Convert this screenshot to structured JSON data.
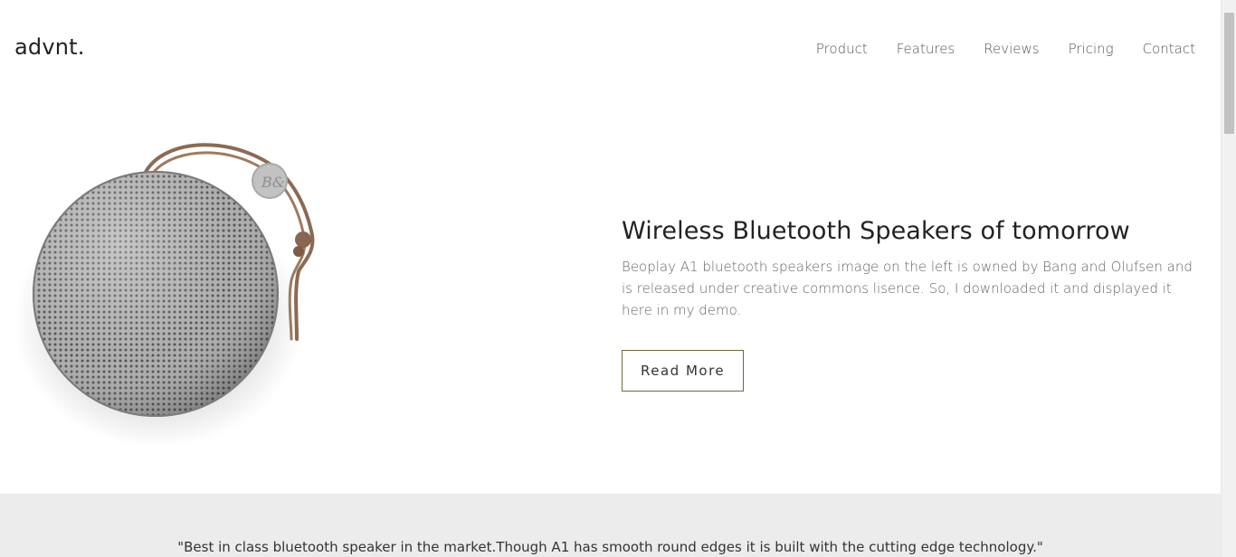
{
  "header": {
    "logo": "advnt.",
    "nav": [
      "Product",
      "Features",
      "Reviews",
      "Pricing",
      "Contact"
    ]
  },
  "hero": {
    "image_icon": "bluetooth-speaker-image",
    "title": "Wireless Bluetooth Speakers of tomorrow",
    "description": "Beoplay A1 bluetooth speakers image on the left is owned by Bang and Olufsen and is released under creative commons lisence. So, I downloaded it and displayed it here in my demo.",
    "cta_label": "Read More",
    "cta_border_color": "#6f6a3a"
  },
  "testimonial": {
    "quote": "\"Best in class bluetooth speaker in the market.Though A1 has smooth round edges it is built with the cutting edge technology.\"",
    "background": "#ececec"
  }
}
